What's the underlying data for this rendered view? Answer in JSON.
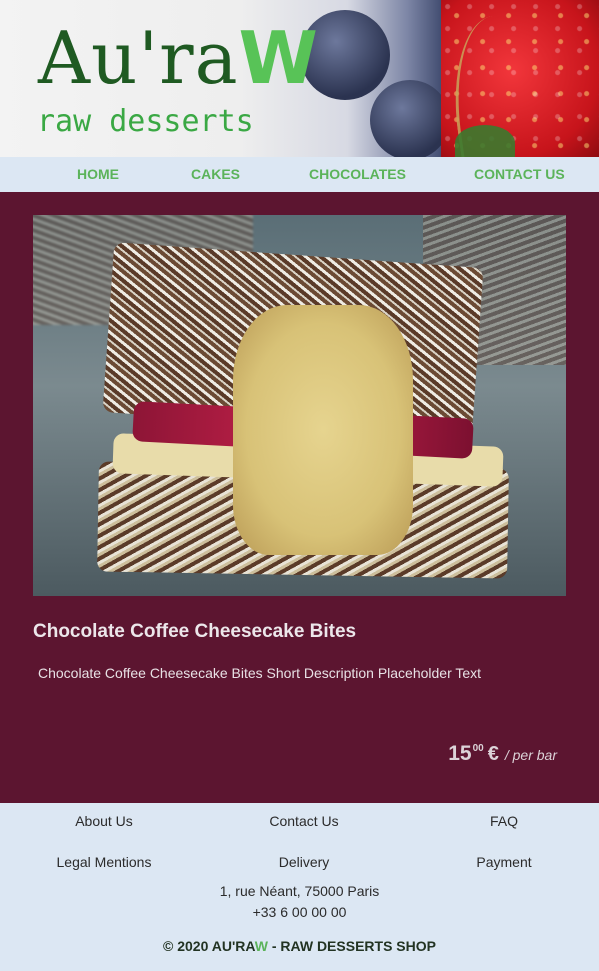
{
  "brand": {
    "logo_main": "Au'ra",
    "logo_accent": "W",
    "tagline": "raw desserts"
  },
  "nav": {
    "items": [
      "HOME",
      "CAKES",
      "CHOCOLATES",
      "CONTACT US"
    ]
  },
  "product": {
    "title": "Chocolate Coffee Cheesecake Bites",
    "description": "Chocolate Coffee Cheesecake Bites Short Description Placeholder Text",
    "price_whole": "15",
    "price_cents": "00",
    "currency": "€",
    "unit": "/ per bar"
  },
  "footer": {
    "links_row1": [
      "About Us",
      "Contact Us",
      "FAQ"
    ],
    "links_row2": [
      "Legal Mentions",
      "Delivery",
      "Payment"
    ],
    "address": "1, rue Néant, 75000 Paris",
    "phone": "+33 6 00 00 00",
    "copyright_pre": "© 2020 AU'RA",
    "copyright_accent": "W",
    "copyright_post": " - RAW DESSERTS SHOP"
  },
  "colors": {
    "brand_dark_green": "#1f5a22",
    "brand_light_green": "#5bb35a",
    "main_background": "#5c1530",
    "nav_footer_background": "#dce7f3"
  }
}
